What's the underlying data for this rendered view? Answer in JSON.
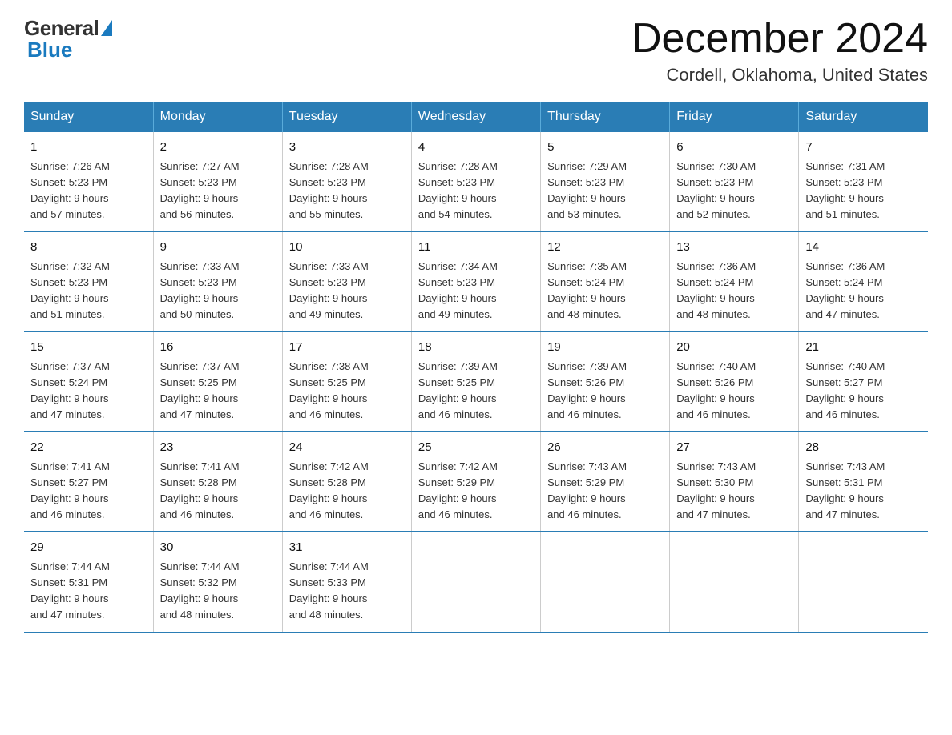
{
  "header": {
    "logo_general": "General",
    "logo_blue": "Blue",
    "month_title": "December 2024",
    "location": "Cordell, Oklahoma, United States"
  },
  "days_of_week": [
    "Sunday",
    "Monday",
    "Tuesday",
    "Wednesday",
    "Thursday",
    "Friday",
    "Saturday"
  ],
  "weeks": [
    [
      {
        "day": "1",
        "sunrise": "7:26 AM",
        "sunset": "5:23 PM",
        "daylight": "9 hours and 57 minutes."
      },
      {
        "day": "2",
        "sunrise": "7:27 AM",
        "sunset": "5:23 PM",
        "daylight": "9 hours and 56 minutes."
      },
      {
        "day": "3",
        "sunrise": "7:28 AM",
        "sunset": "5:23 PM",
        "daylight": "9 hours and 55 minutes."
      },
      {
        "day": "4",
        "sunrise": "7:28 AM",
        "sunset": "5:23 PM",
        "daylight": "9 hours and 54 minutes."
      },
      {
        "day": "5",
        "sunrise": "7:29 AM",
        "sunset": "5:23 PM",
        "daylight": "9 hours and 53 minutes."
      },
      {
        "day": "6",
        "sunrise": "7:30 AM",
        "sunset": "5:23 PM",
        "daylight": "9 hours and 52 minutes."
      },
      {
        "day": "7",
        "sunrise": "7:31 AM",
        "sunset": "5:23 PM",
        "daylight": "9 hours and 51 minutes."
      }
    ],
    [
      {
        "day": "8",
        "sunrise": "7:32 AM",
        "sunset": "5:23 PM",
        "daylight": "9 hours and 51 minutes."
      },
      {
        "day": "9",
        "sunrise": "7:33 AM",
        "sunset": "5:23 PM",
        "daylight": "9 hours and 50 minutes."
      },
      {
        "day": "10",
        "sunrise": "7:33 AM",
        "sunset": "5:23 PM",
        "daylight": "9 hours and 49 minutes."
      },
      {
        "day": "11",
        "sunrise": "7:34 AM",
        "sunset": "5:23 PM",
        "daylight": "9 hours and 49 minutes."
      },
      {
        "day": "12",
        "sunrise": "7:35 AM",
        "sunset": "5:24 PM",
        "daylight": "9 hours and 48 minutes."
      },
      {
        "day": "13",
        "sunrise": "7:36 AM",
        "sunset": "5:24 PM",
        "daylight": "9 hours and 48 minutes."
      },
      {
        "day": "14",
        "sunrise": "7:36 AM",
        "sunset": "5:24 PM",
        "daylight": "9 hours and 47 minutes."
      }
    ],
    [
      {
        "day": "15",
        "sunrise": "7:37 AM",
        "sunset": "5:24 PM",
        "daylight": "9 hours and 47 minutes."
      },
      {
        "day": "16",
        "sunrise": "7:37 AM",
        "sunset": "5:25 PM",
        "daylight": "9 hours and 47 minutes."
      },
      {
        "day": "17",
        "sunrise": "7:38 AM",
        "sunset": "5:25 PM",
        "daylight": "9 hours and 46 minutes."
      },
      {
        "day": "18",
        "sunrise": "7:39 AM",
        "sunset": "5:25 PM",
        "daylight": "9 hours and 46 minutes."
      },
      {
        "day": "19",
        "sunrise": "7:39 AM",
        "sunset": "5:26 PM",
        "daylight": "9 hours and 46 minutes."
      },
      {
        "day": "20",
        "sunrise": "7:40 AM",
        "sunset": "5:26 PM",
        "daylight": "9 hours and 46 minutes."
      },
      {
        "day": "21",
        "sunrise": "7:40 AM",
        "sunset": "5:27 PM",
        "daylight": "9 hours and 46 minutes."
      }
    ],
    [
      {
        "day": "22",
        "sunrise": "7:41 AM",
        "sunset": "5:27 PM",
        "daylight": "9 hours and 46 minutes."
      },
      {
        "day": "23",
        "sunrise": "7:41 AM",
        "sunset": "5:28 PM",
        "daylight": "9 hours and 46 minutes."
      },
      {
        "day": "24",
        "sunrise": "7:42 AM",
        "sunset": "5:28 PM",
        "daylight": "9 hours and 46 minutes."
      },
      {
        "day": "25",
        "sunrise": "7:42 AM",
        "sunset": "5:29 PM",
        "daylight": "9 hours and 46 minutes."
      },
      {
        "day": "26",
        "sunrise": "7:43 AM",
        "sunset": "5:29 PM",
        "daylight": "9 hours and 46 minutes."
      },
      {
        "day": "27",
        "sunrise": "7:43 AM",
        "sunset": "5:30 PM",
        "daylight": "9 hours and 47 minutes."
      },
      {
        "day": "28",
        "sunrise": "7:43 AM",
        "sunset": "5:31 PM",
        "daylight": "9 hours and 47 minutes."
      }
    ],
    [
      {
        "day": "29",
        "sunrise": "7:44 AM",
        "sunset": "5:31 PM",
        "daylight": "9 hours and 47 minutes."
      },
      {
        "day": "30",
        "sunrise": "7:44 AM",
        "sunset": "5:32 PM",
        "daylight": "9 hours and 48 minutes."
      },
      {
        "day": "31",
        "sunrise": "7:44 AM",
        "sunset": "5:33 PM",
        "daylight": "9 hours and 48 minutes."
      },
      null,
      null,
      null,
      null
    ]
  ],
  "labels": {
    "sunrise": "Sunrise:",
    "sunset": "Sunset:",
    "daylight": "Daylight:"
  }
}
